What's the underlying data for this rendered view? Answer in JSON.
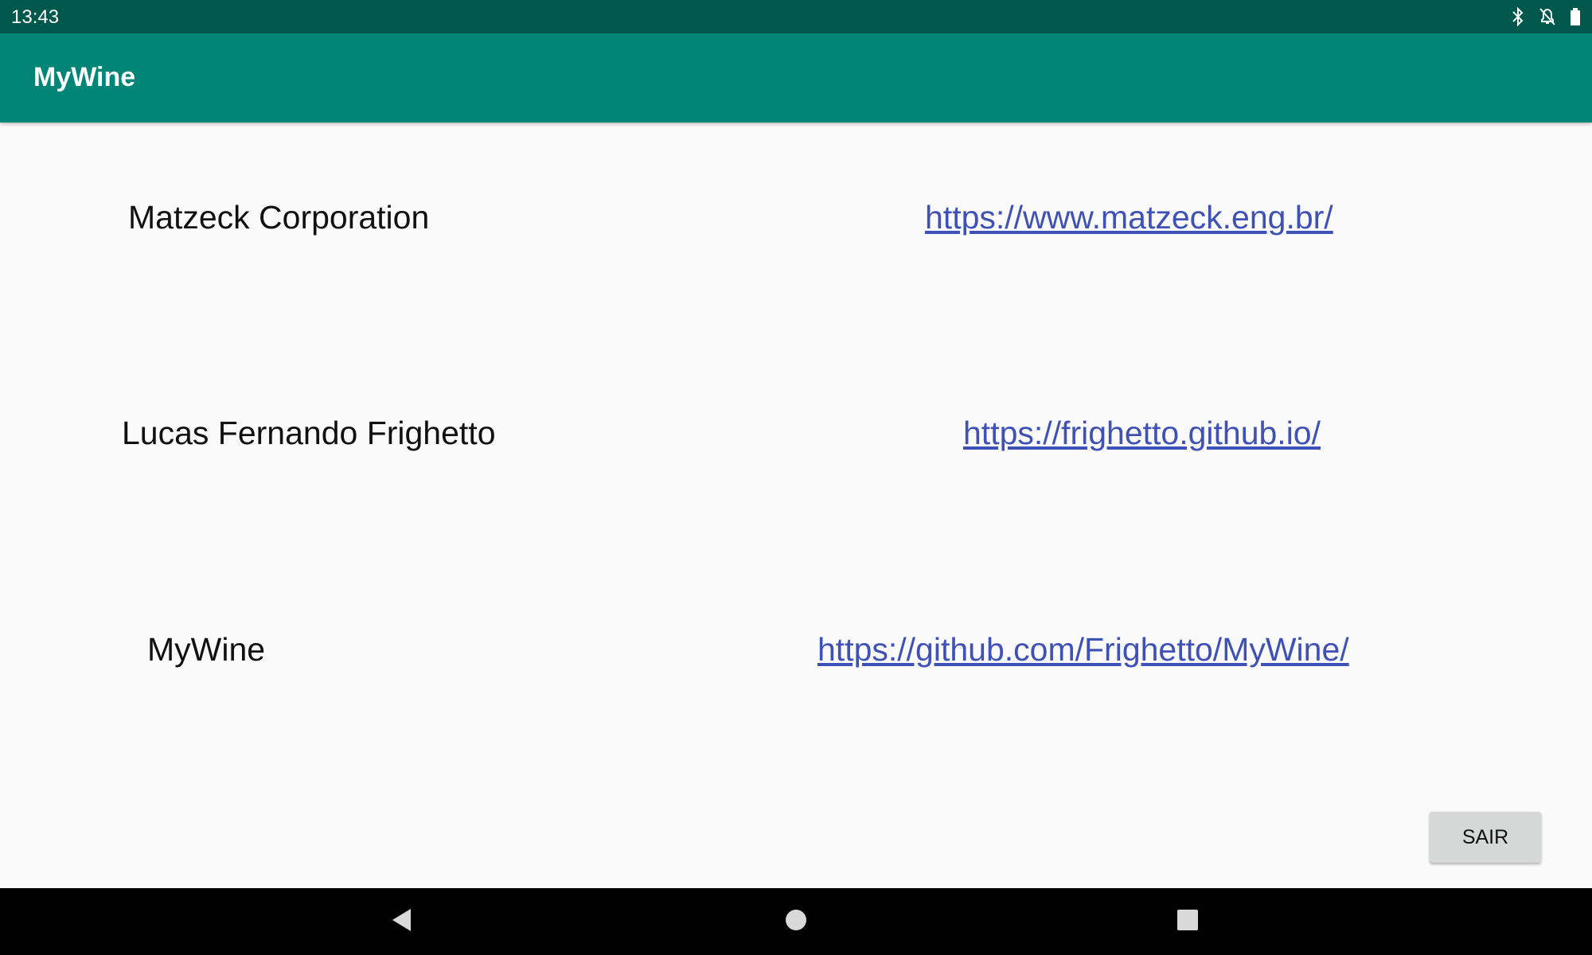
{
  "status_bar": {
    "time": "13:43",
    "icons": [
      "bluetooth-icon",
      "notifications-off-icon",
      "battery-icon"
    ]
  },
  "app_bar": {
    "title": "MyWine"
  },
  "rows": [
    {
      "name": "Matzeck Corporation",
      "link": "https://www.matzeck.eng.br/"
    },
    {
      "name": "Lucas Fernando Frighetto",
      "link": "https://frighetto.github.io/"
    },
    {
      "name": "MyWine",
      "link": "https://github.com/Frighetto/MyWine/"
    }
  ],
  "exit_button": {
    "label": "SAIR"
  },
  "nav_bar": {
    "icons": [
      "back-icon",
      "home-icon",
      "recents-icon"
    ]
  },
  "colors": {
    "status_bar": "#00574b",
    "app_bar": "#008577",
    "link": "#3f51b5",
    "background": "#fafafa",
    "button": "#d6d7d7"
  }
}
